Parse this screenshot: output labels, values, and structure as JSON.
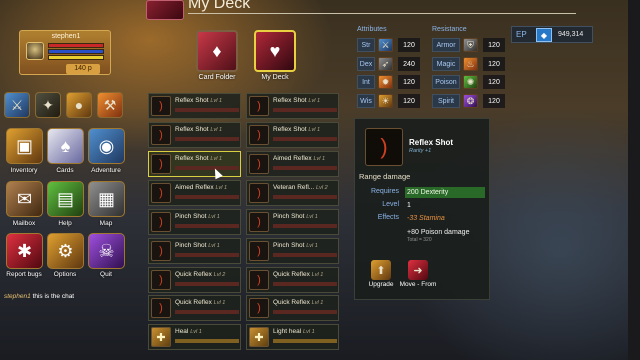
{
  "player": {
    "name": "stephen1",
    "gold": "140 p",
    "hp": 1.0,
    "mp": 1.0,
    "xp": 1.0
  },
  "quick_icons": [
    "sword-icon",
    "claw-icon",
    "mace-icon",
    "axe-icon"
  ],
  "menu": [
    {
      "label": "Inventory",
      "icon": "chest-icon"
    },
    {
      "label": "Cards",
      "icon": "cards-icon"
    },
    {
      "label": "Adventure",
      "icon": "globe-icon"
    },
    {
      "label": "Mailbox",
      "icon": "envelope-icon"
    },
    {
      "label": "Help",
      "icon": "book-icon"
    },
    {
      "label": "Map",
      "icon": "map-icon"
    },
    {
      "label": "Report bugs",
      "icon": "ladybug-icon"
    },
    {
      "label": "Options",
      "icon": "gear-icon"
    },
    {
      "label": "Quit",
      "icon": "skull-icon"
    }
  ],
  "chat": {
    "who": "stephen1",
    "text": "this is the chat"
  },
  "deck": {
    "title": "My Deck",
    "card_folder_label": "Card Folder",
    "my_deck_label": "My Deck"
  },
  "attributes": {
    "heading": "Attributes",
    "items": [
      {
        "name": "Str",
        "value": "120"
      },
      {
        "name": "Dex",
        "value": "240"
      },
      {
        "name": "Int",
        "value": "120"
      },
      {
        "name": "Wis",
        "value": "120"
      }
    ]
  },
  "resistance": {
    "heading": "Resistance",
    "items": [
      {
        "name": "Armor",
        "value": "120"
      },
      {
        "name": "Magic",
        "value": "120"
      },
      {
        "name": "Poison",
        "value": "120"
      },
      {
        "name": "Spirit",
        "value": "120"
      }
    ]
  },
  "ep": {
    "label": "EP",
    "value": "949,314"
  },
  "cards_left": [
    {
      "name": "Reflex Shot",
      "lvl": "Lvl 1"
    },
    {
      "name": "Reflex Shot",
      "lvl": "Lvl 1"
    },
    {
      "name": "Reflex Shot",
      "lvl": "Lvl 1"
    },
    {
      "name": "Aimed Reflex",
      "lvl": "Lvl 1"
    },
    {
      "name": "Pinch Shot",
      "lvl": "Lvl 1"
    },
    {
      "name": "Pinch Shot",
      "lvl": "Lvl 1"
    },
    {
      "name": "Quick Reflex",
      "lvl": "Lvl 2"
    },
    {
      "name": "Quick Reflex",
      "lvl": "Lvl 1"
    },
    {
      "name": "Heal",
      "lvl": "Lvl 1"
    }
  ],
  "cards_right": [
    {
      "name": "Reflex Shot",
      "lvl": "Lvl 1"
    },
    {
      "name": "Reflex Shot",
      "lvl": "Lvl 1"
    },
    {
      "name": "Aimed Reflex",
      "lvl": "Lvl 1"
    },
    {
      "name": "Veteran Refl...",
      "lvl": "Lvl 2"
    },
    {
      "name": "Pinch Shot",
      "lvl": "Lvl 1"
    },
    {
      "name": "Pinch Shot",
      "lvl": "Lvl 1"
    },
    {
      "name": "Quick Reflex",
      "lvl": "Lvl 1"
    },
    {
      "name": "Quick Reflex",
      "lvl": "Lvl 1"
    },
    {
      "name": "Light heal",
      "lvl": "Lvl 1"
    }
  ],
  "detail": {
    "name": "Reflex Shot",
    "rarity": "Rarity +1",
    "type": "Range damage",
    "requires_label": "Requires",
    "requires_value": "200 Dexterity",
    "level_label": "Level",
    "level_value": "1",
    "effects_label": "Effects",
    "effect_stamina": "-33 Stamina",
    "effect_poison": "+80 Poison damage",
    "effect_total": "Total = 320",
    "upgrade_label": "Upgrade",
    "move_label": "Move - From"
  }
}
